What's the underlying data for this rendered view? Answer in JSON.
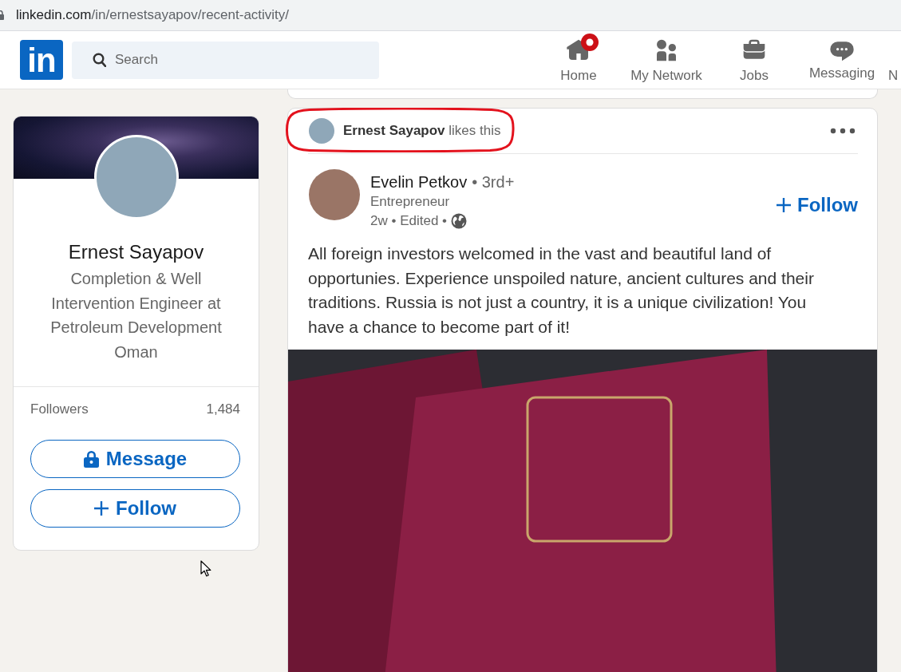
{
  "browser": {
    "url": "**linkedin.com**/in/ernestsayapov/recent-activity/"
  },
  "nav": {
    "logo": "in",
    "search": {
      "placeholder": "Search"
    },
    "items": [
      {
        "label": "Home",
        "badge": true,
        "selected": false
      },
      {
        "label": "My Network",
        "badge": false,
        "selected": false
      },
      {
        "label": "Jobs",
        "badge": false,
        "selected": false
      },
      {
        "label": "Messaging",
        "badge": false,
        "selected": false
      },
      {
        "label": "N",
        "badge": false,
        "selected": false
      }
    ]
  },
  "profile": {
    "name": "Ernest Sayapov",
    "headline": "Completion & Well Intervention Engineer at Petroleum Development Oman",
    "stats": [
      {
        "label": "Followers",
        "value": "1,484"
      }
    ],
    "buttons": [
      {
        "label": "Message"
      },
      {
        "label": "Follow"
      }
    ]
  },
  "post": {
    "activity": {
      "text": "**Ernest Sayapov** likes this",
      "highlighted": true
    },
    "author": {
      "name": "Evelin Petkov",
      "degree": "• 3rd+",
      "headline": "Entrepreneur",
      "meta": "2w • Edited •",
      "follow": "Follow"
    },
    "text": "All foreign investors welcomed in the vast and beautiful land of opportunies. Experience unspoiled nature, ancient cultures and their traditions. Russia is not just a country, it is a unique civilization! You have a chance to become part of it!"
  }
}
